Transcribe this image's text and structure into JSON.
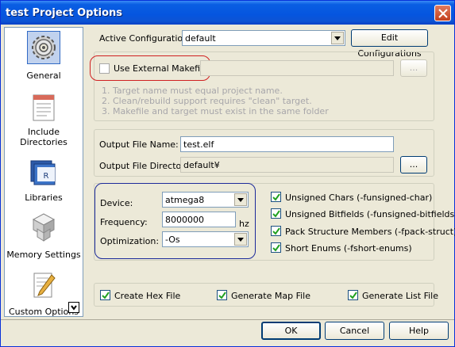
{
  "window": {
    "title": "test Project Options"
  },
  "sidebar": {
    "items": [
      {
        "label": "General",
        "icon": "gear-icon",
        "selected": true
      },
      {
        "label": "Include Directories",
        "icon": "include-directories-icon",
        "selected": false
      },
      {
        "label": "Libraries",
        "icon": "libraries-icon",
        "selected": false
      },
      {
        "label": "Memory Settings",
        "icon": "memory-settings-icon",
        "selected": false
      },
      {
        "label": "Custom Options",
        "icon": "custom-options-icon",
        "selected": false
      }
    ]
  },
  "config": {
    "label": "Active Configuration",
    "value": "default",
    "edit_button": "Edit Configurations"
  },
  "makefile": {
    "checkbox_label": "Use External Makefile",
    "checked": false,
    "path_value": "",
    "browse_label": "...",
    "notes": [
      "1. Target name must equal project name.",
      "2. Clean/rebuild support requires \"clean\" target.",
      "3. Makefile and target must exist in the same folder"
    ]
  },
  "output": {
    "file_name_label": "Output File Name:",
    "file_name_value": "test.elf",
    "directory_label": "Output File Directory:",
    "directory_value": "default¥",
    "browse_label": "..."
  },
  "device": {
    "device_label": "Device:",
    "device_value": "atmega8",
    "frequency_label": "Frequency:",
    "frequency_value": "8000000",
    "frequency_unit": "hz",
    "optimization_label": "Optimization:",
    "optimization_value": "-Os"
  },
  "flags": [
    {
      "label": "Unsigned Chars (-funsigned-char)",
      "checked": true
    },
    {
      "label": "Unsigned Bitfields (-funsigned-bitfields)",
      "checked": true
    },
    {
      "label": "Pack Structure Members (-fpack-struct)",
      "checked": true
    },
    {
      "label": "Short Enums (-fshort-enums)",
      "checked": true
    }
  ],
  "outputs": [
    {
      "label": "Create Hex File",
      "checked": true
    },
    {
      "label": "Generate Map File",
      "checked": true
    },
    {
      "label": "Generate List File",
      "checked": true
    }
  ],
  "buttons": {
    "ok": "OK",
    "cancel": "Cancel",
    "help": "Help"
  }
}
